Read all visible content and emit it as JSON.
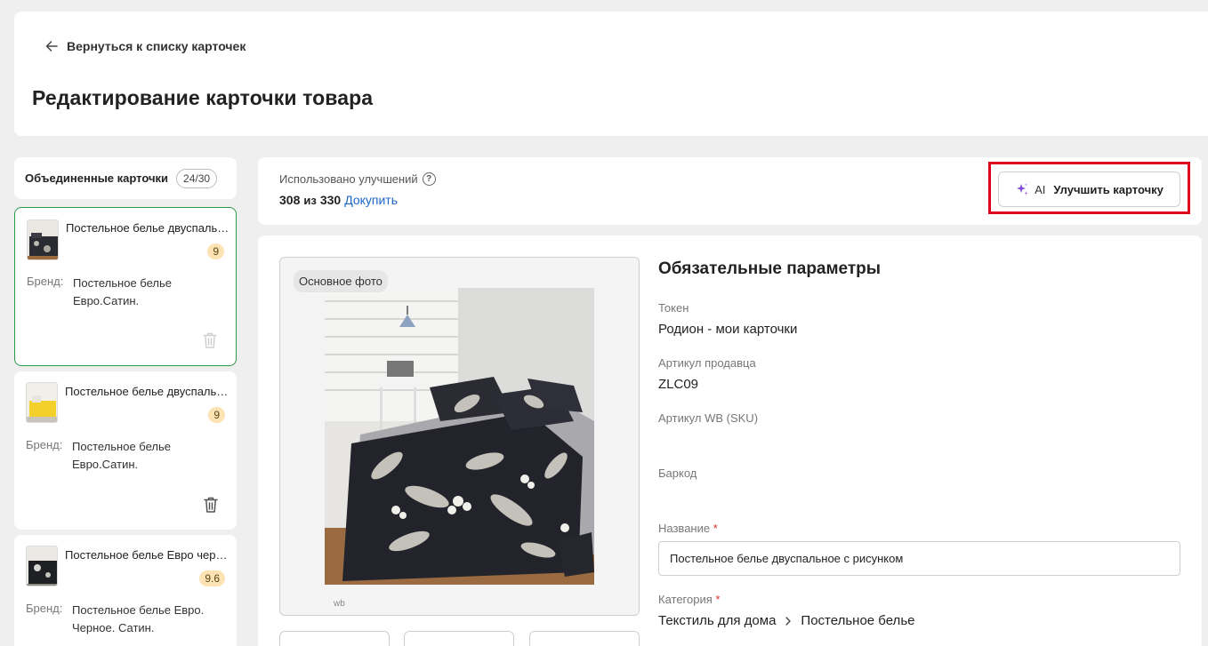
{
  "header": {
    "back_label": "Вернуться к списку карточек",
    "page_title": "Редактирование карточки товара"
  },
  "sidebar": {
    "title": "Объединенные карточки",
    "count": "24/30",
    "brand_label": "Бренд:",
    "cards": [
      {
        "name": "Постельное белье двуспальное с рисунком",
        "score": "9",
        "brand": "Постельное белье Евро.Сатин.",
        "active": true
      },
      {
        "name": "Постельное белье двуспальное желтое",
        "score": "9",
        "brand": "Постельное белье Евро.Сатин.",
        "active": false
      },
      {
        "name": "Постельное белье Евро черное",
        "score": "9.6",
        "brand": "Постельное белье Евро. Черное. Сатин.",
        "active": false
      }
    ]
  },
  "improvements": {
    "label": "Использовано улучшений",
    "help_icon": "?",
    "used": "308",
    "separator": "из",
    "total": "330",
    "buy_label": "Докупить",
    "ai_prefix": "AI",
    "ai_button_label": "Улучшить карточку"
  },
  "photo": {
    "main_badge": "Основное фото",
    "watermark": "wb"
  },
  "params": {
    "title": "Обязательные параметры",
    "token_label": "Токен",
    "token_value": "Родион - мои карточки",
    "seller_sku_label": "Артикул продавца",
    "seller_sku_value": "ZLC09",
    "wb_sku_label": "Артикул WB (SKU)",
    "barcode_label": "Баркод",
    "name_label": "Название",
    "name_value": "Постельное белье двуспальное с рисунком",
    "category_label": "Категория",
    "category_path": [
      "Текстиль для дома",
      "Постельное белье"
    ]
  },
  "colors": {
    "accent_green": "#2c9a4b",
    "link_blue": "#1d66c7",
    "highlight_red": "#e0001b",
    "score_bg": "#fde3b4"
  }
}
